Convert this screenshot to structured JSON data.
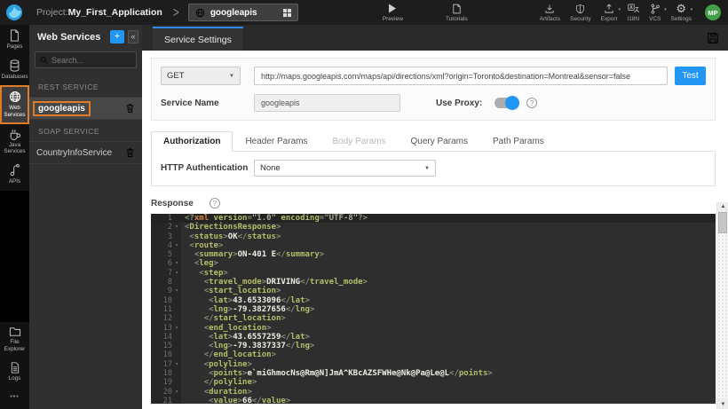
{
  "topbar": {
    "project_prefix": "Project:",
    "project_name": "My_First_Application",
    "service_tab_label": "googleapis",
    "preview_label": "Preview",
    "tutorials_label": "Tutorials",
    "menu": [
      {
        "label": "Artifacts"
      },
      {
        "label": "Security"
      },
      {
        "label": "Export"
      },
      {
        "label": "I18N"
      },
      {
        "label": "VCS"
      },
      {
        "label": "Settings"
      }
    ],
    "avatar_initials": "MP"
  },
  "rail": {
    "items": [
      {
        "label": "Pages"
      },
      {
        "label": "Databases"
      },
      {
        "label": "Web Services",
        "active": true
      },
      {
        "label": "Java Services"
      },
      {
        "label": "APIs"
      }
    ],
    "bottom_items": [
      {
        "label": "File Explorer"
      },
      {
        "label": "Logs"
      }
    ],
    "more": "•••"
  },
  "panel": {
    "title": "Web Services",
    "add_label": "+",
    "collapse_label": "«",
    "search_placeholder": "Search...",
    "sections": [
      {
        "header": "REST SERVICE",
        "items": [
          {
            "name": "googleapis",
            "highlighted": true
          }
        ]
      },
      {
        "header": "SOAP SERVICE",
        "items": [
          {
            "name": "CountryInfoService",
            "highlighted": false
          }
        ]
      }
    ]
  },
  "settings_bar": {
    "tab_label": "Service Settings"
  },
  "form": {
    "method": "GET",
    "url": "http://maps.googleapis.com/maps/api/directions/xml?origin=Toronto&destination=Montreal&sensor=false",
    "test_label": "Test",
    "service_name_label": "Service Name",
    "service_name_value": "googleapis",
    "use_proxy_label": "Use Proxy:",
    "use_proxy_on": true
  },
  "param_tabs": [
    {
      "label": "Authorization",
      "state": "active"
    },
    {
      "label": "Header Params",
      "state": "normal"
    },
    {
      "label": "Body Params",
      "state": "disabled"
    },
    {
      "label": "Query Params",
      "state": "normal"
    },
    {
      "label": "Path Params",
      "state": "normal"
    }
  ],
  "auth": {
    "label": "HTTP Authentication",
    "value": "None"
  },
  "response": {
    "label": "Response"
  },
  "editor": {
    "active_line": 1,
    "folds": [
      2,
      4,
      6,
      7,
      9,
      13,
      17,
      20
    ],
    "lines": [
      "<?xml version=\"1.0\" encoding=\"UTF-8\"?>",
      "<DirectionsResponse>",
      " <status>OK</status>",
      " <route>",
      "  <summary>ON-401 E</summary>",
      "  <leg>",
      "   <step>",
      "    <travel_mode>DRIVING</travel_mode>",
      "    <start_location>",
      "     <lat>43.6533096</lat>",
      "     <lng>-79.3827656</lng>",
      "    </start_location>",
      "    <end_location>",
      "     <lat>43.6557259</lat>",
      "     <lng>-79.3837337</lng>",
      "    </end_location>",
      "    <polyline>",
      "     <points>e`miGhmocNs@Rm@N]JmA^KBcAZSFWHe@Nk@Pa@Le@L</points>",
      "    </polyline>",
      "    <duration>",
      "     <value>66</value>"
    ]
  },
  "colors": {
    "accent_blue": "#2196f3",
    "highlight_orange": "#e07b27",
    "avatar_green": "#43a047",
    "editor_bg": "#2e2e2e"
  }
}
